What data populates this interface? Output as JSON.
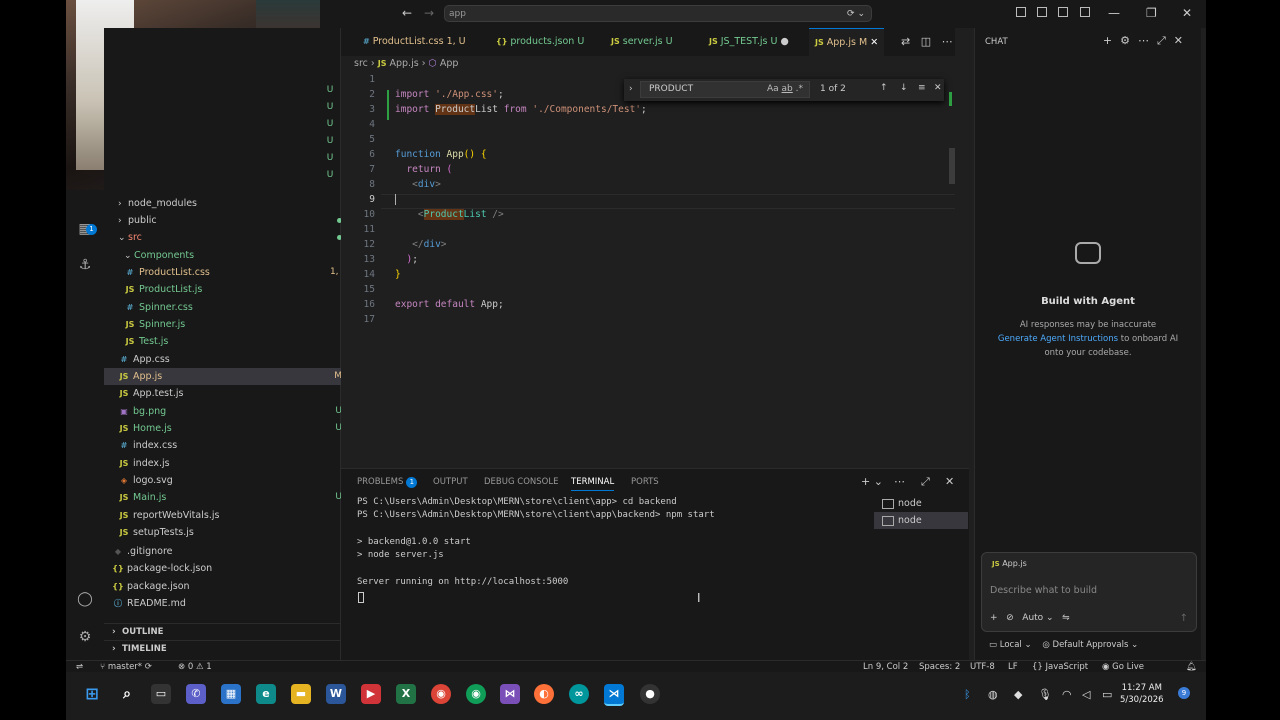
{
  "titlebar": {
    "command_center": "app",
    "window_controls": [
      "minimize",
      "maximize",
      "close"
    ]
  },
  "tabs": [
    {
      "icon": "#",
      "label": "ProductList.css",
      "status": "1, U"
    },
    {
      "icon": "{}",
      "label": "products.json",
      "status": "U"
    },
    {
      "icon": "JS",
      "label": "server.js",
      "status": "U"
    },
    {
      "icon": "JS",
      "label": "JS_TEST.js",
      "status": "U"
    },
    {
      "icon": "JS",
      "label": "App.js",
      "status": "M"
    }
  ],
  "breadcrumb": {
    "folder": "src",
    "file": "App.js",
    "symbol": "App"
  },
  "find": {
    "query": "PRODUCT",
    "result": "1 of 2"
  },
  "editor": {
    "lines": [
      {
        "n": "1",
        "text": ""
      },
      {
        "n": "2",
        "text": "import './App.css';"
      },
      {
        "n": "3",
        "text": "import ProductList from './Components/Test';"
      },
      {
        "n": "4",
        "text": ""
      },
      {
        "n": "5",
        "text": ""
      },
      {
        "n": "6",
        "text": "function App() {"
      },
      {
        "n": "7",
        "text": "  return ("
      },
      {
        "n": "8",
        "text": "   <div>"
      },
      {
        "n": "9",
        "text": ""
      },
      {
        "n": "10",
        "text": "    <ProductList />"
      },
      {
        "n": "11",
        "text": ""
      },
      {
        "n": "12",
        "text": "   </div>"
      },
      {
        "n": "13",
        "text": "  );"
      },
      {
        "n": "14",
        "text": "}"
      },
      {
        "n": "15",
        "text": ""
      },
      {
        "n": "16",
        "text": "export default App;"
      },
      {
        "n": "17",
        "text": ""
      }
    ]
  },
  "explorer": {
    "items": [
      {
        "label": "node_modules",
        "type": "folder",
        "status": ""
      },
      {
        "label": "public",
        "type": "folder",
        "status": "dot"
      },
      {
        "label": "src",
        "type": "folder-open",
        "status": "dot"
      },
      {
        "label": "Components",
        "type": "folder-open",
        "status": "dot"
      },
      {
        "label": "ProductList.css",
        "type": "css",
        "status": "1, U"
      },
      {
        "label": "ProductList.js",
        "type": "js",
        "status": "U"
      },
      {
        "label": "Spinner.css",
        "type": "css",
        "status": "U"
      },
      {
        "label": "Spinner.js",
        "type": "js",
        "status": "U"
      },
      {
        "label": "Test.js",
        "type": "js",
        "status": "U"
      },
      {
        "label": "App.css",
        "type": "css",
        "status": ""
      },
      {
        "label": "App.js",
        "type": "js",
        "status": "M"
      },
      {
        "label": "App.test.js",
        "type": "js",
        "status": ""
      },
      {
        "label": "bg.png",
        "type": "img",
        "status": "U"
      },
      {
        "label": "Home.js",
        "type": "js",
        "status": "U"
      },
      {
        "label": "index.css",
        "type": "css",
        "status": ""
      },
      {
        "label": "index.js",
        "type": "js",
        "status": ""
      },
      {
        "label": "logo.svg",
        "type": "svg",
        "status": ""
      },
      {
        "label": "Main.js",
        "type": "js",
        "status": "U"
      },
      {
        "label": "reportWebVitals.js",
        "type": "js",
        "status": ""
      },
      {
        "label": "setupTests.js",
        "type": "js",
        "status": ""
      },
      {
        "label": ".gitignore",
        "type": "git",
        "status": ""
      },
      {
        "label": "package-lock.json",
        "type": "json",
        "status": ""
      },
      {
        "label": "package.json",
        "type": "json",
        "status": ""
      },
      {
        "label": "README.md",
        "type": "info",
        "status": ""
      }
    ],
    "outline": "OUTLINE",
    "timeline": "TIMELINE",
    "scm_status_column": [
      "U",
      "U",
      "U",
      "U",
      "U",
      "U"
    ]
  },
  "panel": {
    "tabs": [
      {
        "label": "PROBLEMS",
        "badge": "1"
      },
      {
        "label": "OUTPUT"
      },
      {
        "label": "DEBUG CONSOLE"
      },
      {
        "label": "TERMINAL"
      },
      {
        "label": "PORTS"
      }
    ],
    "terminal_lines": [
      "PS C:\\Users\\Admin\\Desktop\\MERN\\store\\client\\app> cd backend",
      "PS C:\\Users\\Admin\\Desktop\\MERN\\store\\client\\app\\backend> npm start",
      "",
      "> backend@1.0.0 start",
      "> node server.js",
      "",
      "Server running on http://localhost:5000"
    ],
    "terminals": [
      "node",
      "node"
    ]
  },
  "chat": {
    "title": "CHAT",
    "heading": "Build with Agent",
    "desc_line1": "AI responses may be inaccurate",
    "desc_link": "Generate Agent Instructions",
    "desc_line2": " to onboard AI onto your codebase.",
    "context_file": "App.js",
    "placeholder": "Describe what to build",
    "mode": "Auto",
    "location": "Local",
    "approvals": "Default Approvals"
  },
  "statusbar": {
    "branch": "master*",
    "errors": "0",
    "warnings": "1",
    "position": "Ln 9, Col 2",
    "spaces": "Spaces: 2",
    "encoding": "UTF-8",
    "eol": "LF",
    "language": "JavaScript",
    "golive": "Go Live"
  },
  "taskbar": {
    "time": "11:27 AM",
    "date": "5/30/2026",
    "notifications": "9"
  }
}
